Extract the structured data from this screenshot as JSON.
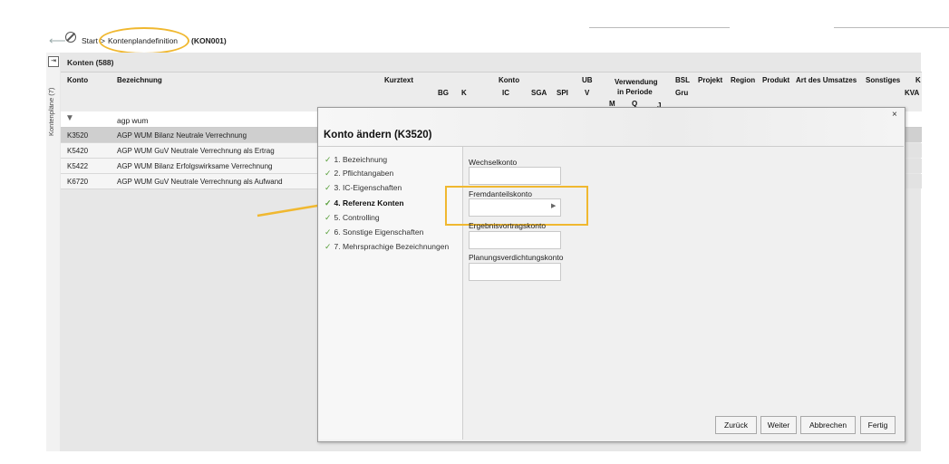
{
  "breadcrumb": {
    "start": "Start",
    "separator": ">",
    "current": "Kontenplandefinition",
    "code": "(KON001)"
  },
  "sidebar": {
    "vertical_label": "Kontenpläne (7)"
  },
  "list": {
    "title": "Konten (588)",
    "columns": {
      "konto": "Konto",
      "bezeichnung": "Bezeichnung",
      "kurztext": "Kurztext",
      "konto_group": "Konto",
      "bg": "BG",
      "k": "K",
      "ic": "IC",
      "sga": "SGA",
      "spi": "SPI",
      "ub": "UB",
      "v": "V",
      "verwendung": "Verwendung",
      "in_periode": "in Periode",
      "m": "M",
      "q": "Q",
      "j": "J",
      "bsl": "BSL",
      "gru": "Gru",
      "projekt": "Projekt",
      "region": "Region",
      "produkt": "Produkt",
      "art_des_umsatzes": "Art des Umsatzes",
      "sonstiges": "Sonstiges",
      "kv": "K",
      "kva": "KVA"
    },
    "filter_value": "agp wum",
    "rows": [
      {
        "konto": "K3520",
        "bezeichnung": "AGP WUM Bilanz Neutrale Verrechnung"
      },
      {
        "konto": "K5420",
        "bezeichnung": "AGP WUM GuV Neutrale Verrechnung als Ertrag"
      },
      {
        "konto": "K5422",
        "bezeichnung": "AGP WUM Bilanz Erfolgswirksame Verrechnung"
      },
      {
        "konto": "K6720",
        "bezeichnung": "AGP WUM GuV Neutrale Verrechnung als Aufwand"
      }
    ]
  },
  "dialog": {
    "title": "Konto ändern (K3520)",
    "close": "×",
    "nav": [
      {
        "label": "1. Bezeichnung",
        "active": false
      },
      {
        "label": "2. Pflichtangaben",
        "active": false
      },
      {
        "label": "3. IC-Eigenschaften",
        "active": false
      },
      {
        "label": "4. Referenz Konten",
        "active": true
      },
      {
        "label": "5. Controlling",
        "active": false
      },
      {
        "label": "6. Sonstige Eigenschaften",
        "active": false
      },
      {
        "label": "7. Mehrsprachige Bezeichnungen",
        "active": false
      }
    ],
    "fields": {
      "wechselkonto": "Wechselkonto",
      "fremdanteilskonto": "Fremdanteilskonto",
      "ergebnisvortragskonto": "Ergebnisvortragskonto",
      "planungsverdichtungskonto": "Planungsverdichtungskonto"
    },
    "buttons": {
      "back": "Zurück",
      "next": "Weiter",
      "cancel": "Abbrechen",
      "finish": "Fertig"
    }
  },
  "colors": {
    "highlight": "#f0b830",
    "check": "#5aa03c"
  }
}
